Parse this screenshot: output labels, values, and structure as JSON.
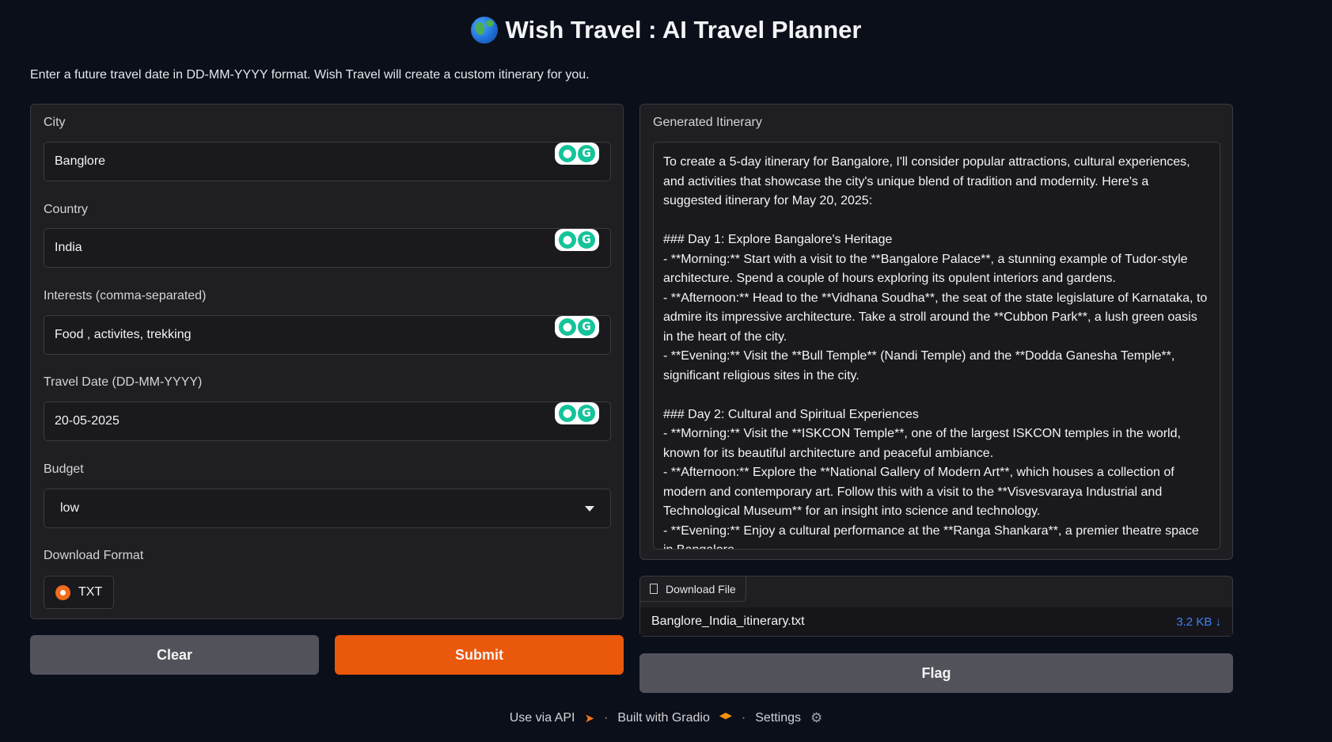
{
  "header": {
    "title": "Wish Travel : AI Travel Planner",
    "globe_icon": "globe-icon",
    "subtitle": "Enter a future travel date in DD-MM-YYYY format. Wish Travel will create a custom itinerary for you."
  },
  "form": {
    "city": {
      "label": "City",
      "value": "Banglore"
    },
    "country": {
      "label": "Country",
      "value": "India"
    },
    "interests": {
      "label": "Interests (comma-separated)",
      "value": "Food , activites, trekking"
    },
    "travel_date": {
      "label": "Travel Date (DD-MM-YYYY)",
      "value": "20-05-2025"
    },
    "budget": {
      "label": "Budget",
      "value": "low"
    },
    "download_format": {
      "label": "Download Format",
      "option": "TXT"
    }
  },
  "buttons": {
    "clear": "Clear",
    "submit": "Submit",
    "flag": "Flag"
  },
  "output": {
    "label": "Generated Itinerary",
    "text": "To create a 5-day itinerary for Bangalore, I'll consider popular attractions, cultural experiences, and activities that showcase the city's unique blend of tradition and modernity. Here's a suggested itinerary for May 20, 2025:\n\n### Day 1: Explore Bangalore's Heritage\n- **Morning:** Start with a visit to the **Bangalore Palace**, a stunning example of Tudor-style architecture. Spend a couple of hours exploring its opulent interiors and gardens.\n- **Afternoon:** Head to the **Vidhana Soudha**, the seat of the state legislature of Karnataka, to admire its impressive architecture. Take a stroll around the **Cubbon Park**, a lush green oasis in the heart of the city.\n- **Evening:** Visit the **Bull Temple** (Nandi Temple) and the **Dodda Ganesha Temple**, significant religious sites in the city.\n\n### Day 2: Cultural and Spiritual Experiences\n- **Morning:** Visit the **ISKCON Temple**, one of the largest ISKCON temples in the world, known for its beautiful architecture and peaceful ambiance.\n- **Afternoon:** Explore the **National Gallery of Modern Art**, which houses a collection of modern and contemporary art. Follow this with a visit to the **Visvesvaraya Industrial and Technological Museum** for an insight into science and technology.\n- **Evening:** Enjoy a cultural performance at the **Ranga Shankara**, a premier theatre space in Bangalore."
  },
  "download": {
    "tab_label": "Download File",
    "filename": "Banglore_India_itinerary.txt",
    "size": "3.2 KB ↓"
  },
  "footer": {
    "api": "Use via API",
    "built": "Built with Gradio",
    "settings": "Settings",
    "separator": "·"
  },
  "colors": {
    "accent": "#ea580c",
    "background": "#0b0f19",
    "link": "#3b82f6"
  }
}
